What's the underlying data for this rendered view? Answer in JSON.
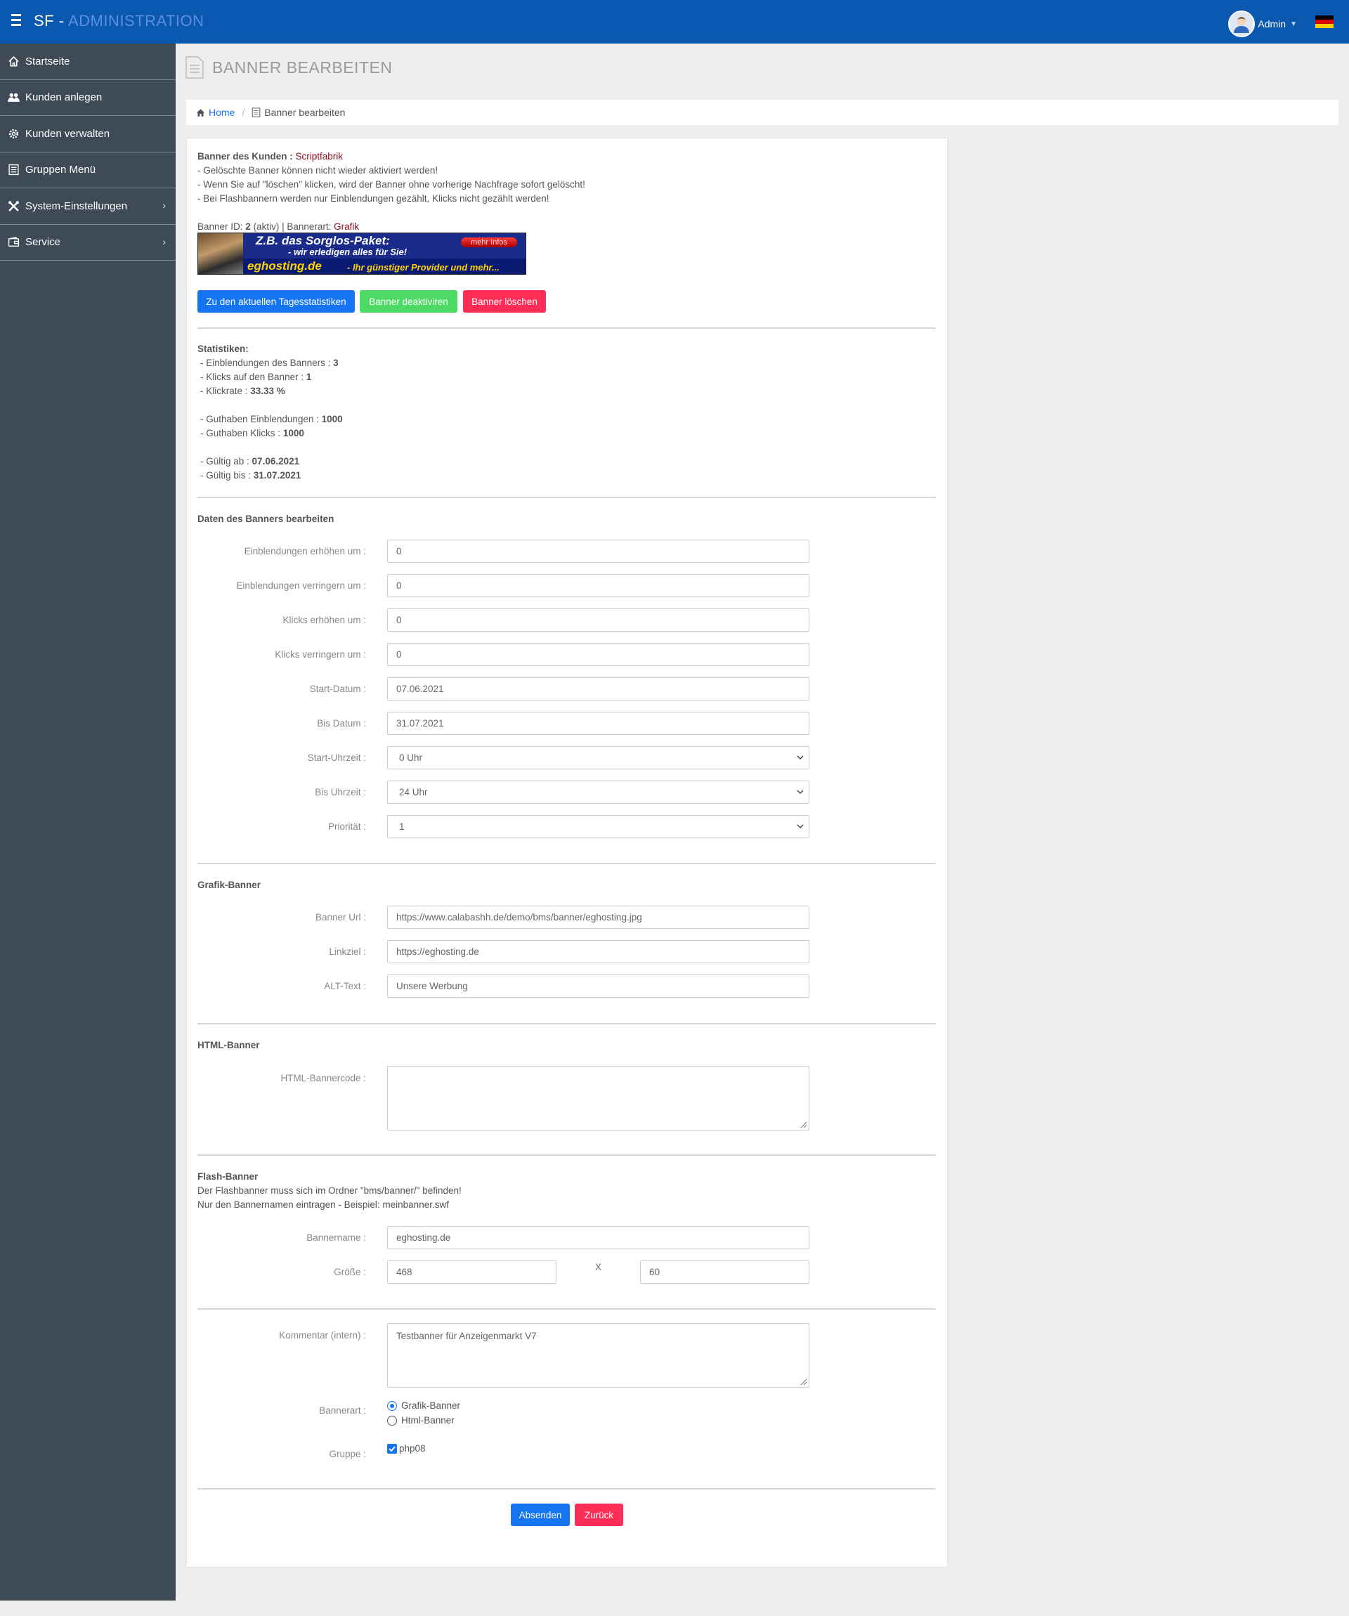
{
  "app": {
    "brand_prefix": "SF - ",
    "brand_accent": "ADMINISTRATION",
    "user": "Admin"
  },
  "sidebar": {
    "items": [
      {
        "label": "Startseite",
        "icon": "home-icon"
      },
      {
        "label": "Kunden anlegen",
        "icon": "users-icon"
      },
      {
        "label": "Kunden verwalten",
        "icon": "gear-icon"
      },
      {
        "label": "Gruppen Menü",
        "icon": "list-icon"
      },
      {
        "label": "System-Einstellungen",
        "icon": "tools-icon"
      },
      {
        "label": "Service",
        "icon": "wallet-icon"
      }
    ]
  },
  "page": {
    "title": "BANNER BEARBEITEN"
  },
  "breadcrumb": {
    "home": "Home",
    "current": "Banner bearbeiten"
  },
  "info": {
    "customer_label": "Banner des Kunden : ",
    "customer_name": "Scriptfabrik",
    "note1": "- Gelöschte Banner können nicht wieder aktiviert werden!",
    "note2": "- Wenn Sie auf \"löschen\" klicken, wird der Banner ohne vorherige Nachfrage sofort gelöscht!",
    "note3": "- Bei Flashbannern werden nur Einblendungen gezählt, Klicks nicht gezählt werden!",
    "banner_id_label": "Banner ID: ",
    "banner_id": "2",
    "banner_status": " (aktiv) | Bannerart: ",
    "banner_type": "Grafik"
  },
  "banner_image": {
    "line1": "Z.B. das Sorglos-Paket:",
    "line2": "- wir erledigen alles für Sie!",
    "line3": "eghosting.de",
    "line4": "-  Ihr günstiger Provider und mehr...",
    "pill": "mehr Infos"
  },
  "actions": {
    "stats": "Zu den aktuellen Tagesstatistiken",
    "deactivate": "Banner deaktiviren",
    "delete": "Banner löschen"
  },
  "stats": {
    "heading": "Statistiken:",
    "impressions_label": "- Einblendungen des Banners : ",
    "impressions": "3",
    "clicks_label": "- Klicks auf den Banner : ",
    "clicks": "1",
    "rate_label": "- Klickrate : ",
    "rate": "33.33 %",
    "credit_impr_label": "- Guthaben Einblendungen : ",
    "credit_impr": "1000",
    "credit_clicks_label": "- Guthaben Klicks : ",
    "credit_clicks": "1000",
    "valid_from_label": "- Gültig ab : ",
    "valid_from": "07.06.2021",
    "valid_to_label": "- Gültig bis : ",
    "valid_to": "31.07.2021"
  },
  "edit": {
    "heading": "Daten des Banners bearbeiten",
    "fields": [
      {
        "label": "Einblendungen erhöhen um :",
        "value": "0"
      },
      {
        "label": "Einblendungen verringern um :",
        "value": "0"
      },
      {
        "label": "Klicks erhöhen um :",
        "value": "0"
      },
      {
        "label": "Klicks verringern um :",
        "value": "0"
      },
      {
        "label": "Start-Datum :",
        "value": "07.06.2021"
      },
      {
        "label": "Bis Datum :",
        "value": "31.07.2021"
      },
      {
        "label": "Start-Uhrzeit :",
        "value": "0 Uhr"
      },
      {
        "label": "Bis Uhrzeit :",
        "value": "24 Uhr"
      },
      {
        "label": "Priorität :",
        "value": "1"
      }
    ]
  },
  "grafik": {
    "heading": "Grafik-Banner",
    "fields": [
      {
        "label": "Banner Url :",
        "value": "https://www.calabashh.de/demo/bms/banner/eghosting.jpg"
      },
      {
        "label": "Linkziel :",
        "value": "https://eghosting.de"
      },
      {
        "label": "ALT-Text :",
        "value": "Unsere Werbung"
      }
    ]
  },
  "html": {
    "heading": "HTML-Banner",
    "label": "HTML-Bannercode :",
    "value": ""
  },
  "flash": {
    "heading": "Flash-Banner",
    "note1": "Der Flashbanner muss sich im Ordner \"bms/banner/\" befinden!",
    "note2": "Nur den Bannernamen eintragen - Beispiel: meinbanner.swf",
    "name_label": "Bannername :",
    "name_value": "eghosting.de",
    "size_label": "Größe :",
    "width": "468",
    "x": "X",
    "height": "60"
  },
  "misc": {
    "comment_label": "Kommentar (intern) :",
    "comment_value": "Testbanner für Anzeigenmarkt V7",
    "type_label": "Bannerart :",
    "type_opt1": "Grafik-Banner",
    "type_opt2": "Html-Banner",
    "group_label": "Gruppe :",
    "group_opt": "php08"
  },
  "footer_buttons": {
    "submit": "Absenden",
    "back": "Zurück"
  },
  "colors": {
    "topbar": "#0a58b0",
    "sidebar": "#3e4b57",
    "primary": "#1574f0",
    "success": "#4cd964",
    "danger": "#ff2d55",
    "accent_red": "#8b0c1c"
  }
}
